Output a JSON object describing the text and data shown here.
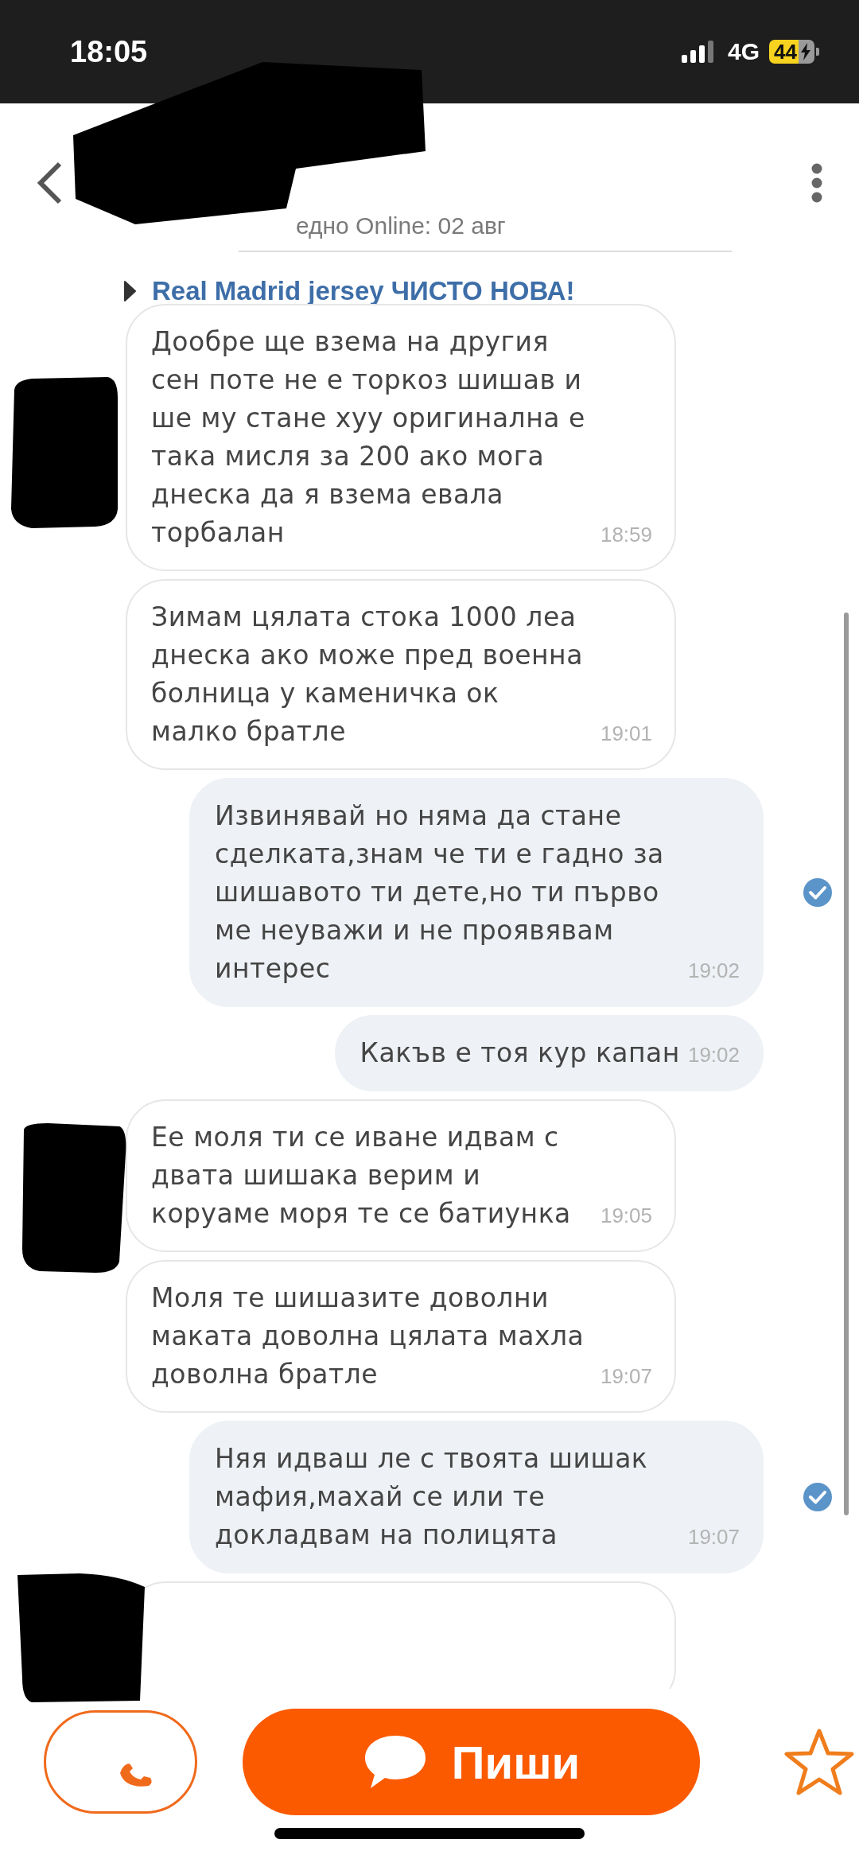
{
  "status_bar": {
    "time": "18:05",
    "network": "4G",
    "battery": "44"
  },
  "header": {
    "last_seen": "едно Online: 02 авг"
  },
  "listing": {
    "title": "Real Madrid jersey ЧИСТО НОВА!"
  },
  "messages": [
    {
      "kind": "incoming",
      "text": "Дообре ще взема на другия сен поте не е торкоз шишав и ше му стане хуу оригинална е така мисля за 200 ако мога днеска да я взема евала торбалан",
      "time": "18:59"
    },
    {
      "kind": "incoming",
      "text": "Зимам цялата стока 1000 леа днеска ако може пред военна болница у каменичка ок малко братле",
      "time": "19:01"
    },
    {
      "kind": "outgoing",
      "text": "Извинявай но няма да стане сделката,знам че ти е гадно за шишавото ти дете,но ти първо ме неуважи и не проявявам интерес",
      "time": "19:02",
      "read": true
    },
    {
      "kind": "outgoing",
      "text": "Какъв е тоя кур капан",
      "time": "19:02",
      "read": false
    },
    {
      "kind": "incoming",
      "text": "Ее моля ти се иване идвам с двата шишака верим и коруаме моря те се батиунка",
      "time": "19:05"
    },
    {
      "kind": "incoming",
      "text": "Моля те шишазите доволни маката доволна цялата махла доволна братле",
      "time": "19:07"
    },
    {
      "kind": "outgoing",
      "text": "Няя идваш ле с твоята шишак мафия,махай се или те докладвам на полицята",
      "time": "19:07",
      "read": true
    },
    {
      "kind": "incoming"
    }
  ],
  "bottom_bar": {
    "write_button": "Пиши"
  }
}
